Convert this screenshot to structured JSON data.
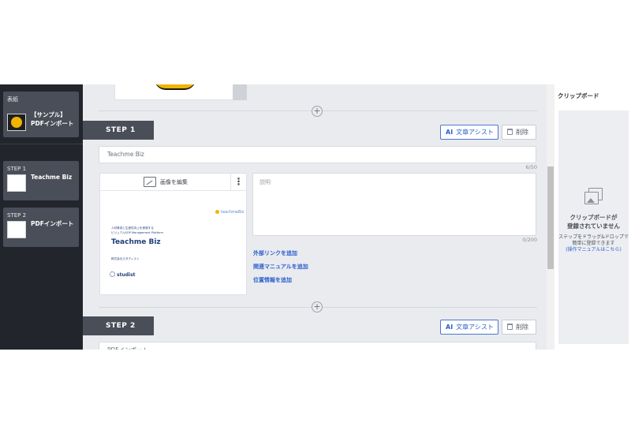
{
  "sidebar": {
    "cover": {
      "tag": "表紙",
      "title": "【サンプル】PDFインポート"
    },
    "steps": [
      {
        "tag": "STEP 1",
        "title": "Teachme Biz"
      },
      {
        "tag": "STEP 2",
        "title": "PDFインポート"
      }
    ]
  },
  "steps": [
    {
      "label": "STEP 1",
      "ai_assist": "文章アシスト",
      "ai_mark": "AI",
      "delete": "削除",
      "title_value": "Teachme Biz",
      "title_counter": "6/50",
      "image_edit_label": "画像を編集",
      "kebab": "⋮",
      "description_placeholder": "説明",
      "description_counter": "0/200",
      "links": [
        "外部リンクを追加",
        "関連マニュアルを追加",
        "位置情報を追加"
      ],
      "slide": {
        "logo": "teachmeBiz",
        "sub1": "人材育成と生産性向上を実現する",
        "sub2": "ビジュアルSOP Management Platform",
        "title": "Teachme Biz",
        "company": "株式会社スタディスト",
        "brand": "studist"
      }
    },
    {
      "label": "STEP 2",
      "ai_assist": "文章アシスト",
      "ai_mark": "AI",
      "delete": "削除",
      "title_value": "PDFインポート"
    }
  ],
  "clipboard": {
    "title": "クリップボード",
    "empty_line1": "クリップボードが",
    "empty_line2": "登録されていません",
    "help_line1": "ステップをドラッグ&ドロップで",
    "help_line2": "簡単に登録できます",
    "help_link": "(操作マニュアルはこちら)"
  },
  "icons": {
    "plus": "+",
    "edit": "image-edit-icon",
    "trash": "trash-icon",
    "clipboard": "images-icon"
  },
  "colors": {
    "sidebar_bg": "#22252c",
    "step_tag_bg": "#4a4e58",
    "accent_blue": "#2d5fcc",
    "canvas_bg": "#e9ebef"
  }
}
